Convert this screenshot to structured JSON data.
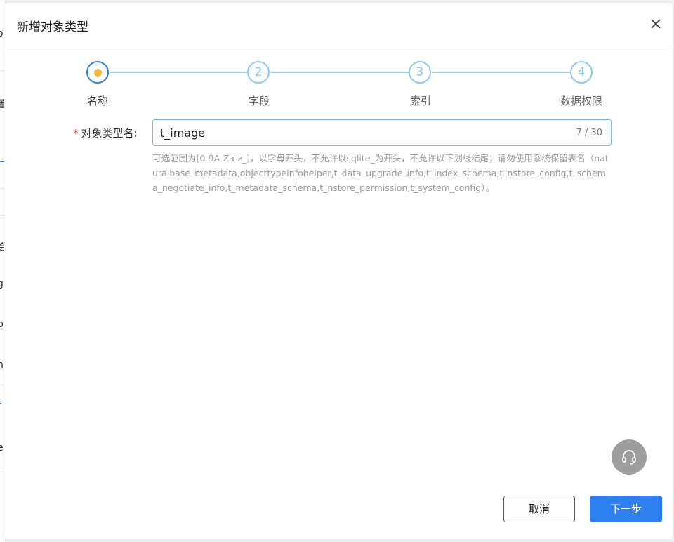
{
  "dialog": {
    "title": "新增对象类型"
  },
  "steps": [
    {
      "number": "1",
      "label": "名称",
      "state": "active"
    },
    {
      "number": "2",
      "label": "字段",
      "state": "pending"
    },
    {
      "number": "3",
      "label": "索引",
      "state": "pending"
    },
    {
      "number": "4",
      "label": "数据权限",
      "state": "pending"
    }
  ],
  "form": {
    "required_mark": "*",
    "label": "对象类型名:",
    "value": "t_image",
    "counter": "7 / 30",
    "hint": "可选范围为[0-9A-Za-z_]，以字母开头，不允许以sqlite_为开头，不允许以下划线结尾；请勿使用系统保留表名（naturalbase_metadata,objecttypeinfohelper,t_data_upgrade_info,t_index_schema,t_nstore_config,t_schema_negotiate_info,t_metadata_schema,t_nstore_permission,t_system_config）。"
  },
  "buttons": {
    "cancel": "取消",
    "next": "下一步"
  },
  "background": {
    "edge_chars": [
      "o",
      "置",
      "会",
      "g",
      "p",
      "n",
      "r",
      "e"
    ]
  },
  "colors": {
    "primary": "#2e7ff0",
    "step_pending": "#8fc8f2",
    "step_dot": "#f5b73b",
    "required": "#e84a4a"
  },
  "icons": {
    "close": "close-icon",
    "support": "headset-icon"
  }
}
